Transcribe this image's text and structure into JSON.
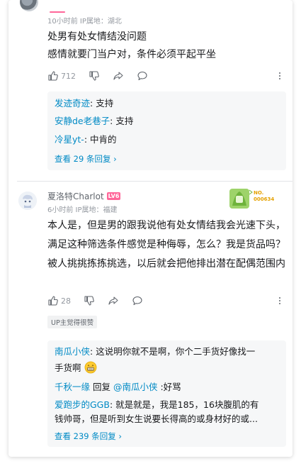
{
  "comment1": {
    "meta": "10小时前  IP属地：湖北",
    "lines": [
      "处男有处女情结没问题",
      "感情就要门当户对，条件必须平起平坐"
    ],
    "like_count": "712",
    "replies": [
      {
        "user": "发迹奇迹",
        "text": ": 支持"
      },
      {
        "user": "安静de老巷子",
        "text": ": 支持"
      },
      {
        "user": "冷星yt-",
        "text": ": 中肯的"
      }
    ],
    "view_more": "查看 29 条回复 ›"
  },
  "comment2": {
    "username": "夏洛特Charlot",
    "level": "LV6",
    "meta": "6小时前  IP属地：福建",
    "fan_badge": {
      "label": "NO.",
      "number": "000634"
    },
    "text": "本人是，但是男的跟我说他有处女情结我会光速下头，满足这种筛选条件感觉是种侮辱，怎么？我是货品吗？被人挑挑拣拣挑选，以后就会把他排出潜在配偶范围内",
    "like_count": "28",
    "up_tag": "UP主觉得很赞",
    "replies": [
      {
        "user": "南瓜小侠",
        "text": ": 这说明你就不是啊，你个二手货好像找一",
        "text2": "手货啊"
      },
      {
        "user": "千秋一缘",
        "mid": " 回复 ",
        "mention": "@南瓜小侠",
        "text": " :好骂"
      },
      {
        "user": "爱跑步的GGB",
        "text": ": 就是就是，我是185，16块腹肌的有",
        "text2": "钱帅哥，但是听到女生说要长得高的或身材好的或..."
      }
    ],
    "view_more": "查看 239 条回复 ›"
  },
  "colors": {
    "link": "#008ac5",
    "accent": "#ff6699",
    "meta": "#9499a0"
  },
  "icons": [
    "thumb-up-icon",
    "thumb-down-icon",
    "share-icon",
    "reply-bubble-icon",
    "more-dots-icon",
    "grin-emoji-icon"
  ]
}
